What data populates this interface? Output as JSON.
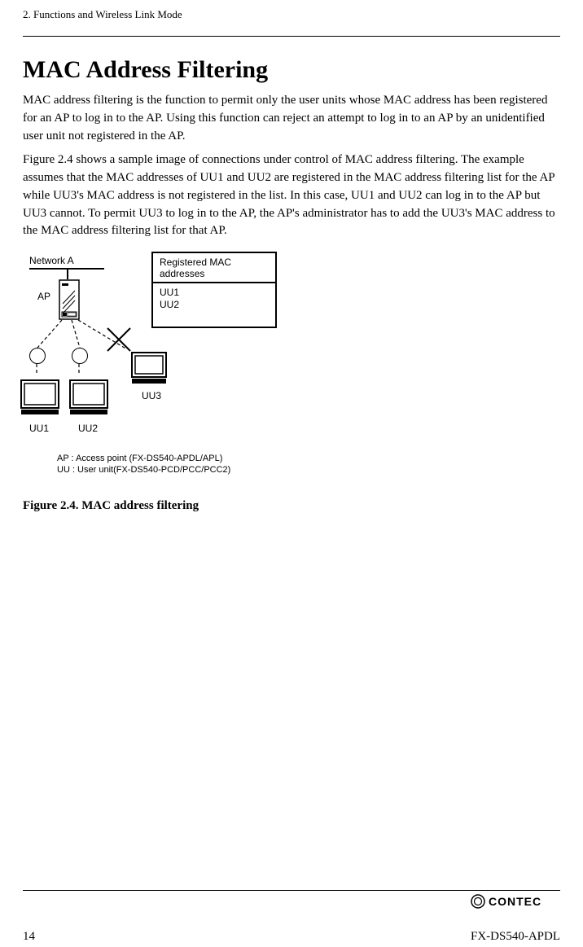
{
  "chapter": "2.  Functions and Wireless Link Mode",
  "title": "MAC Address Filtering",
  "para1": "MAC address filtering is the function to permit only the user units whose MAC address has been registered for an AP to log in to the AP.  Using this function can reject an attempt to log in to an AP by an unidentified user unit not registered in the AP.",
  "para2": "Figure 2.4 shows a sample image of connections under control of MAC address filtering.  The example assumes that the MAC addresses of UU1 and UU2 are registered in the MAC address filtering list for the AP while UU3's MAC address is not registered in the list.  In this case, UU1 and UU2 can log in to the AP but UU3 cannot.  To permit UU3 to log in to the AP, the AP's administrator has to add the UU3's MAC address to the MAC address filtering list for that AP.",
  "figure": {
    "network_label": "Network A",
    "ap_label": "AP",
    "table_header": "Registered MAC addresses",
    "table_row1": "UU1",
    "table_row2": "UU2",
    "uu1": "UU1",
    "uu2": "UU2",
    "uu3": "UU3",
    "legend_line1": "AP : Access point (FX-DS540-APDL/APL)",
    "legend_line2": "UU : User unit(FX-DS540-PCD/PCC/PCC2)"
  },
  "figure_caption": "Figure 2.4.  MAC address filtering",
  "footer": {
    "page_num": "14",
    "brand": "CONTEC",
    "model": "FX-DS540-APDL"
  }
}
